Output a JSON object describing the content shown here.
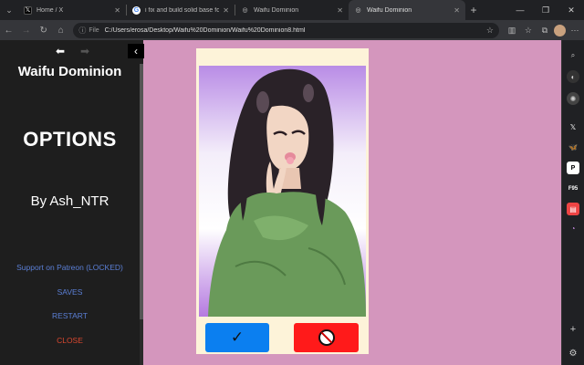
{
  "browser": {
    "tabs": [
      {
        "label": "Home / X",
        "icon": "x-logo-icon",
        "active": false
      },
      {
        "label": "i fix and build solid base for a g",
        "icon": "google-icon",
        "active": false
      },
      {
        "label": "Waifu Dominion",
        "icon": "globe-icon",
        "active": false
      },
      {
        "label": "Waifu Dominion",
        "icon": "globe-icon",
        "active": true
      }
    ],
    "file_label": "File",
    "url": "C:/Users/erosa/Desktop/Waifu%20Dominion/Waifu%20Dominion8.html"
  },
  "game": {
    "title": "Waifu Dominion",
    "heading": "OPTIONS",
    "author": "By Ash_NTR",
    "menu": [
      {
        "label": "Support on Patreon (LOCKED)",
        "color": "#5b7fd6"
      },
      {
        "label": "SAVES",
        "color": "#5b7fd6"
      },
      {
        "label": "RESTART",
        "color": "#5b7fd6"
      },
      {
        "label": "CLOSE",
        "color": "#d9472f"
      }
    ],
    "accept_symbol": "✓",
    "colors": {
      "background": "#d496bd",
      "sidebar": "#1e1e1e",
      "card": "#fdf3d9",
      "accept": "#0b7ff0",
      "reject": "#ff1a1a"
    }
  }
}
